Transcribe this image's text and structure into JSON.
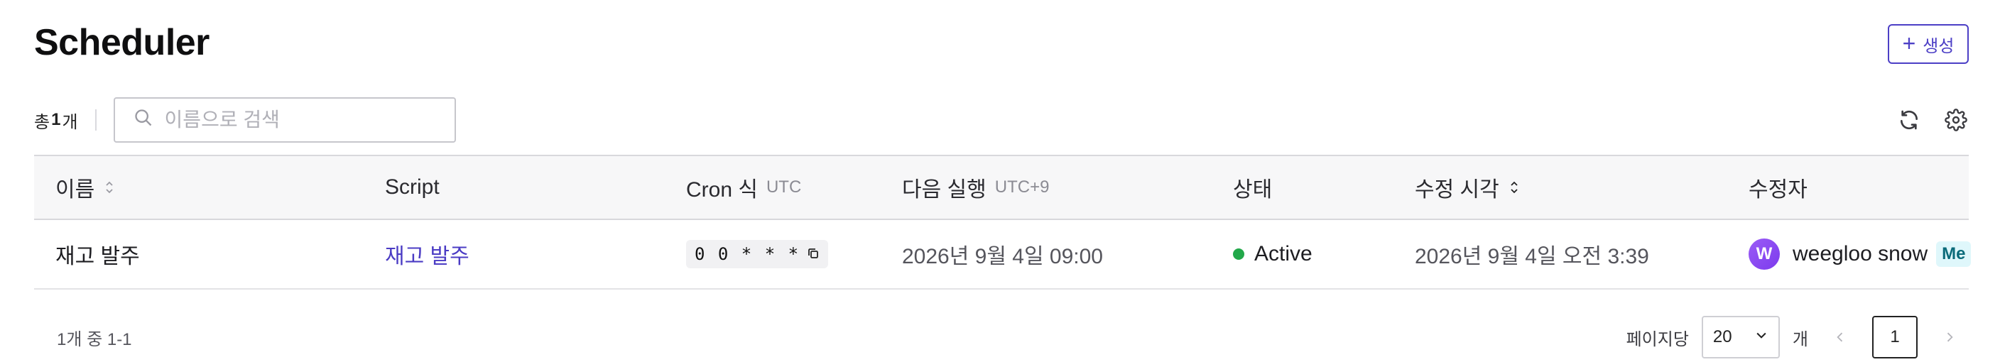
{
  "page": {
    "title": "Scheduler"
  },
  "toolbar": {
    "create_label": "생성",
    "total_prefix": "총",
    "total_count": "1",
    "total_suffix": "개",
    "search_placeholder": "이름으로 검색"
  },
  "table": {
    "headers": {
      "name": "이름",
      "script": "Script",
      "cron": "Cron 식",
      "cron_unit": "UTC",
      "next_run": "다음 실행",
      "next_run_unit": "UTC+9",
      "status": "상태",
      "modified_at": "수정 시각",
      "modified_by": "수정자"
    },
    "rows": [
      {
        "name": "재고 발주",
        "script": "재고 발주",
        "cron": "0 0 * * *",
        "next_run": "2026년 9월 4일 09:00",
        "status": "Active",
        "modified_at": "2026년 9월 4일 오전 3:39",
        "modified_by": "weegloo snow",
        "avatar_letter": "W",
        "me_badge": "Me"
      }
    ]
  },
  "footer": {
    "range": "1개 중 1-1",
    "per_page_label": "페이지당",
    "per_page_value": "20",
    "per_page_unit": "개",
    "current_page": "1"
  },
  "colors": {
    "accent": "#4c3fc6",
    "status_active": "#22a84a"
  },
  "icons": [
    "plus-icon",
    "search-icon",
    "refresh-icon",
    "settings-gear-icon",
    "sort-icon",
    "copy-icon",
    "chevron-down-icon",
    "chevron-left-icon",
    "chevron-right-icon"
  ]
}
